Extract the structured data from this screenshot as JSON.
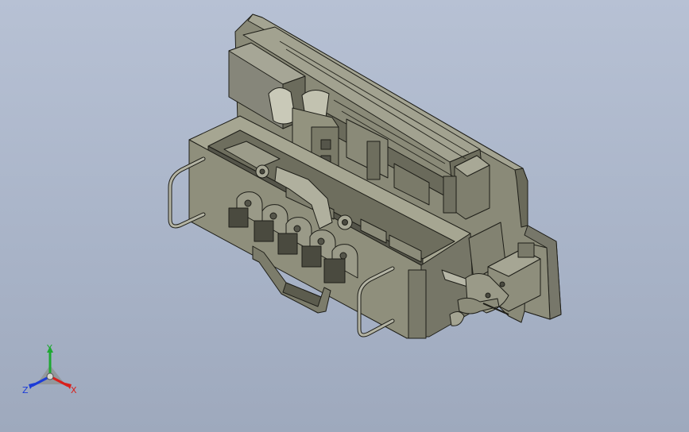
{
  "colors": {
    "background_top": "#b7c1d4",
    "background_bottom": "#9ea9bd",
    "part_light": "#9a9a88",
    "part_mid": "#7d7d6c",
    "part_dark": "#5c5c4e",
    "edge": "#1e1e18",
    "axis_x": "#d8201c",
    "axis_y": "#1ea832",
    "axis_z": "#1c3cd8"
  },
  "triad": {
    "x_label": "X",
    "y_label": "Y",
    "z_label": "Z"
  }
}
